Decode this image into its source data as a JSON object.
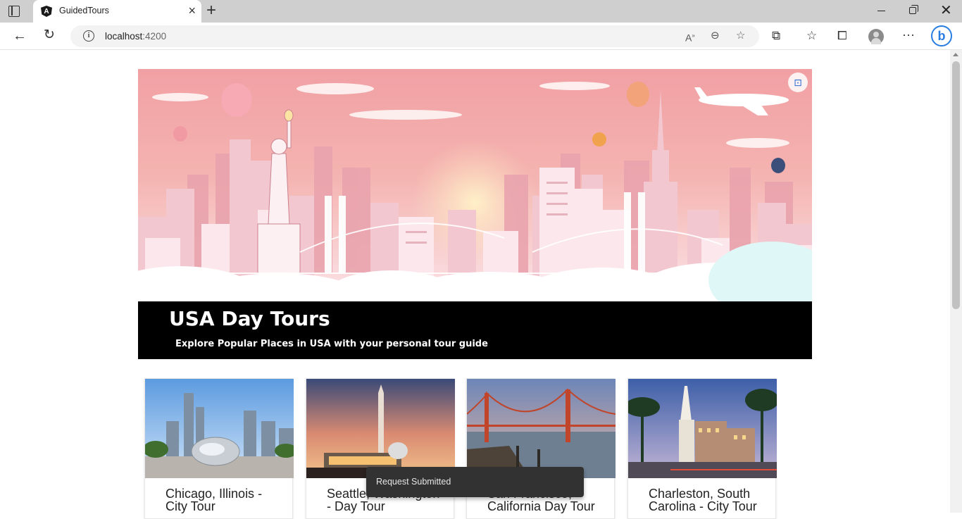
{
  "browser": {
    "tab_title": "GuidedTours",
    "url_host": "localhost",
    "url_port": ":4200"
  },
  "hero": {
    "title": "USA Day Tours",
    "subtitle": "Explore Popular Places in USA with your personal tour guide"
  },
  "tours": [
    {
      "title": "Chicago, Illinois - City Tour"
    },
    {
      "title": "Seattle, Washington - Day Tour"
    },
    {
      "title": "San Francisco, California Day Tour"
    },
    {
      "title": "Charleston, South Carolina - City Tour"
    }
  ],
  "snackbar": {
    "message": "Request Submitted"
  },
  "icons": {
    "tab_favicon": "angular-logo-icon",
    "zoom": "visual-search-icon"
  }
}
